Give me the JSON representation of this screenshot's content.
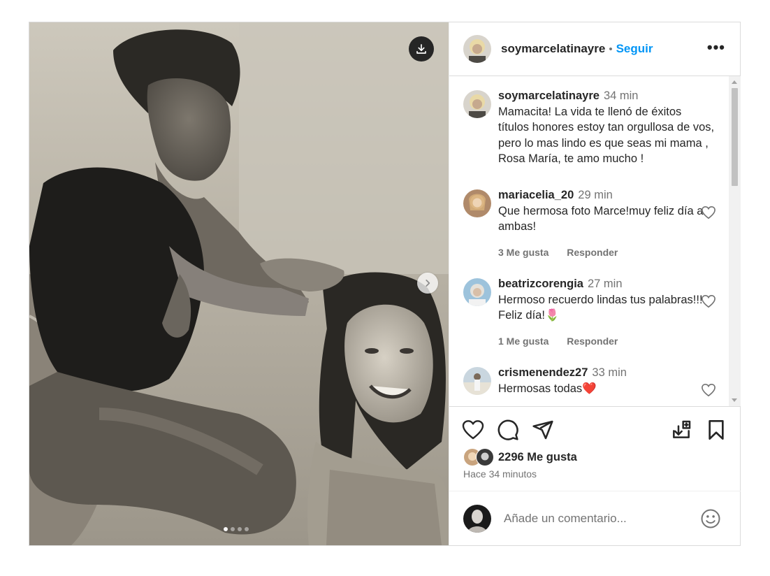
{
  "post": {
    "media": {
      "image_description_icon": "black-and-white-beach-photo",
      "carousel_total": 4,
      "carousel_active": 1
    },
    "header": {
      "username": "soymarcelatinayre",
      "separator": "•",
      "follow_label": "Seguir",
      "more_icon": "more-horizontal-icon"
    },
    "caption": {
      "username": "soymarcelatinayre",
      "time": "34 min",
      "text": "Mamacita! La vida te llenó de éxitos títulos honores estoy tan orgullosa de vos, pero lo mas lindo es que seas mi mama , Rosa María, te amo mucho !"
    },
    "comments": [
      {
        "username": "mariacelia_20",
        "time": "29 min",
        "text": "Que hermosa foto Marce!muy feliz día a ambas!",
        "likes": "3 Me gusta",
        "reply": "Responder"
      },
      {
        "username": "beatrizcorengia",
        "time": "27 min",
        "text": "Hermoso recuerdo lindas tus palabras!!! Feliz día!🌷",
        "likes": "1 Me gusta",
        "reply": "Responder"
      },
      {
        "username": "crismenendez27",
        "time": "33 min",
        "text": "Hermosas todas❤️"
      }
    ],
    "likes_text": "2296 Me gusta",
    "posted_ago": "Hace 34 minutos",
    "comment_placeholder": "Añade un comentario...",
    "colors": {
      "accent": "#0095f6",
      "text": "#262626",
      "muted": "#737373",
      "border": "#dbdbdb"
    }
  }
}
